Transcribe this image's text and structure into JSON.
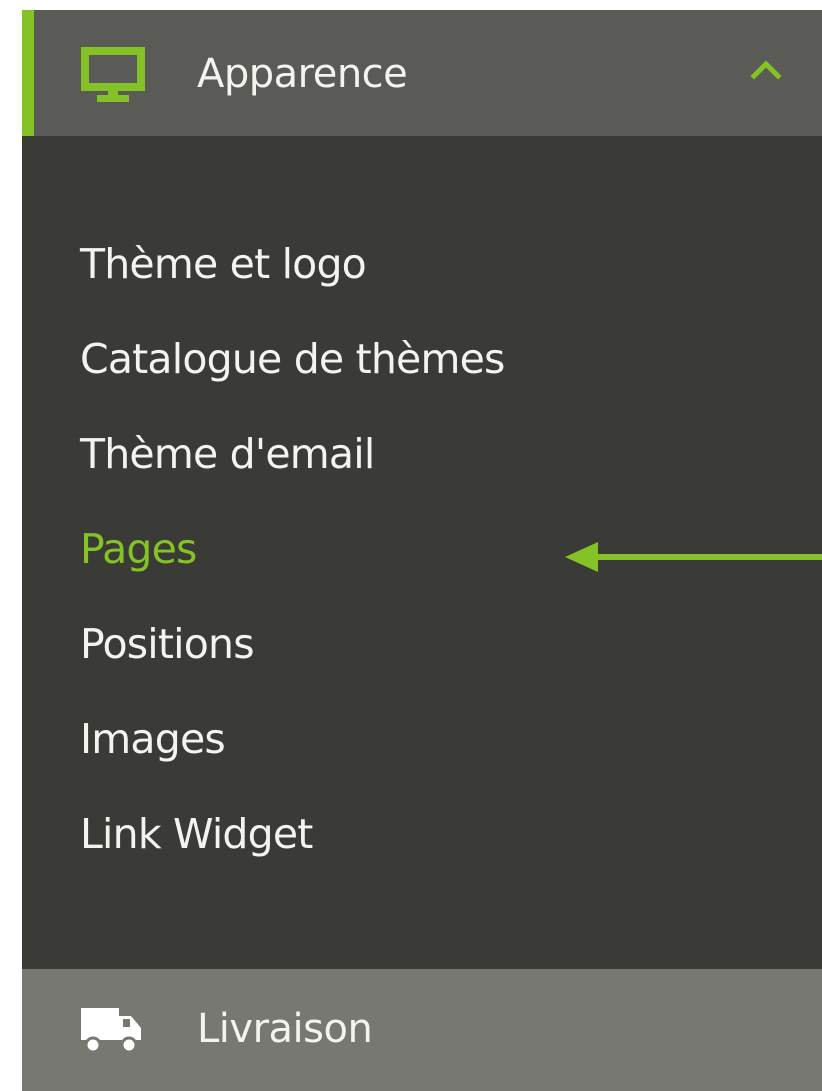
{
  "colors": {
    "accent": "#84c225",
    "header_bg": "#5a5b56",
    "menu_bg": "#3a3a36",
    "footer_bg": "#777872",
    "text": "#f3f3ef"
  },
  "header": {
    "label": "Apparence",
    "icon": "monitor-icon",
    "expand_icon": "chevron-up-icon"
  },
  "submenu": {
    "items": [
      {
        "label": "Thème et logo",
        "active": false
      },
      {
        "label": "Catalogue de thèmes",
        "active": false
      },
      {
        "label": "Thème d'email",
        "active": false
      },
      {
        "label": "Pages",
        "active": true
      },
      {
        "label": "Positions",
        "active": false
      },
      {
        "label": "Images",
        "active": false
      },
      {
        "label": "Link Widget",
        "active": false
      }
    ]
  },
  "annotation": {
    "icon": "pointer-arrow-icon"
  },
  "footer": {
    "label": "Livraison",
    "icon": "truck-icon"
  }
}
